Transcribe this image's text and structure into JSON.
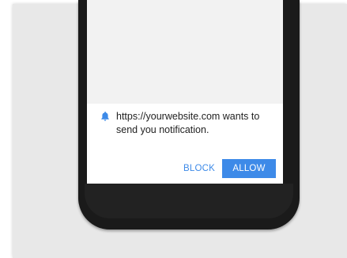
{
  "notification": {
    "icon": "bell-icon",
    "message": "https://yourwebsite.com wants to send you notification.",
    "block_label": "BLOCK",
    "allow_label": "ALLOW"
  },
  "colors": {
    "accent": "#3d8ae8",
    "phone_body": "#1a1a1a",
    "background": "#e8e8e8"
  }
}
